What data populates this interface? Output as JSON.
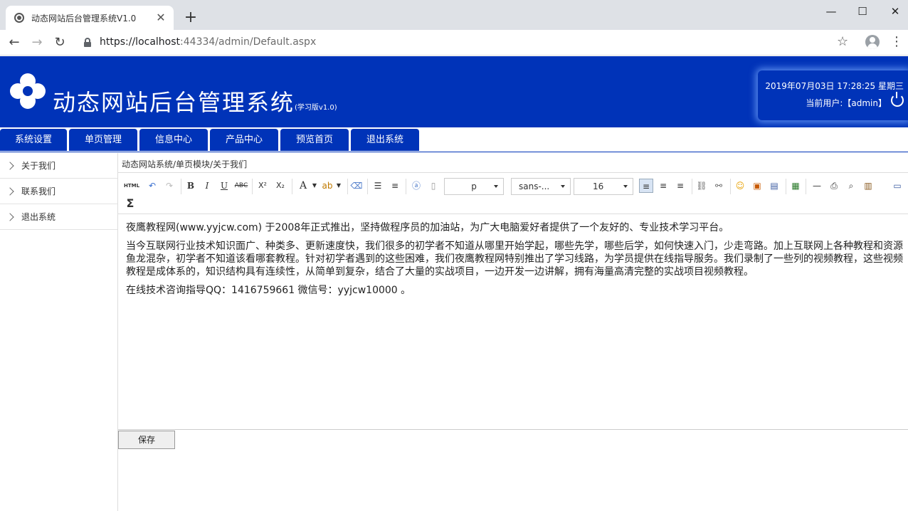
{
  "browser": {
    "tab_title": "动态网站后台管理系统V1.0",
    "url_host": "https://localhost",
    "url_rest": ":44334/admin/Default.aspx"
  },
  "header": {
    "title": "动态网站后台管理系统",
    "subtitle": "(学习版v1.0)",
    "datetime": "2019年07月03日 17:28:25 星期三",
    "current_user": "当前用户:【admin】"
  },
  "topnav": [
    "系统设置",
    "单页管理",
    "信息中心",
    "产品中心",
    "预览首页",
    "退出系统"
  ],
  "sidebar": [
    "关于我们",
    "联系我们",
    "退出系统"
  ],
  "breadcrumb": "动态网站系统/单页模块/关于我们",
  "toolbar": {
    "format_value": "p",
    "font_value": "sans-...",
    "size_value": "16",
    "html_label": "HTML"
  },
  "content": {
    "p1": "夜鹰教程网(www.yyjcw.com) 于2008年正式推出，坚持做程序员的加油站，为广大电脑爱好者提供了一个友好的、专业技术学习平台。",
    "p2": "当今互联网行业技术知识面广、种类多、更新速度快，我们很多的初学者不知道从哪里开始学起，哪些先学，哪些后学，如何快速入门，少走弯路。加上互联网上各种教程和资源鱼龙混杂，初学者不知道该看哪套教程。针对初学者遇到的这些困难，我们夜鹰教程网特别推出了学习线路，为学员提供在线指导服务。我们录制了一些列的视频教程，这些视频教程是成体系的，知识结构具有连续性，从简单到复杂，结合了大量的实战项目，一边开发一边讲解，拥有海量高清完整的实战项目视频教程。",
    "p3": "在线技术咨询指导QQ：1416759661 微信号：yyjcw10000 。"
  },
  "save_label": "保存"
}
